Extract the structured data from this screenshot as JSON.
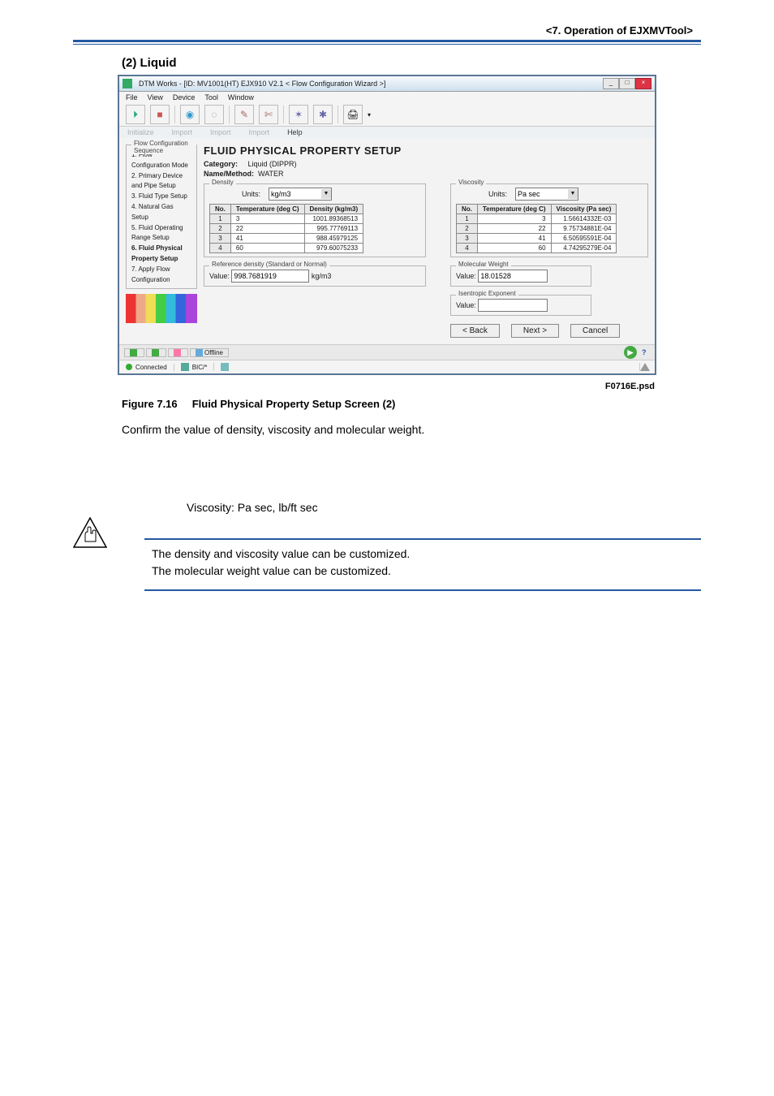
{
  "header": {
    "section": "<7.  Operation of EJXMVTool>"
  },
  "section_head": "(2)   Liquid",
  "window": {
    "title": "DTM Works - [ID: MV1001(HT) EJX910 V2.1 < Flow Configuration Wizard >]",
    "win_btns": {
      "min": "_",
      "max": "□",
      "close": "×"
    },
    "menu": {
      "file": "File",
      "view": "View",
      "device": "Device",
      "tool": "Tool",
      "window": "Window"
    },
    "tabs_label": {
      "init": "Initialize",
      "import1": "Import",
      "import2": "Import",
      "import3": "Import",
      "help": "Help"
    },
    "big_title": "FLUID PHYSICAL PROPERTY SETUP",
    "sidebar": {
      "fs_title": "Flow Configuration Sequence",
      "steps": {
        "s1": "1. Flow Configuration Mode",
        "s2": "2. Primary Device and Pipe Setup",
        "s3": "3. Fluid Type Setup",
        "s4": "4. Natural Gas Setup",
        "s5": "5. Fluid Operating Range Setup",
        "s6": "6. Fluid Physical Property Setup",
        "s7": "7. Apply Flow Configuration"
      }
    },
    "category": {
      "label": "Category:",
      "value": "Liquid (DIPPR)",
      "label2": "Name/Method:",
      "value2": "WATER"
    },
    "density": {
      "fs_title": "Density",
      "units_label": "Units:",
      "units_value": "kg/m3",
      "th": {
        "no": "No.",
        "temp": "Temperature (deg C)",
        "dens": "Density (kg/m3)"
      },
      "rows": [
        {
          "n": "1",
          "t": "3",
          "d": "1001.89368513"
        },
        {
          "n": "2",
          "t": "22",
          "d": "995.77769113"
        },
        {
          "n": "3",
          "t": "41",
          "d": "988.45979125"
        },
        {
          "n": "4",
          "t": "60",
          "d": "979.60075233"
        }
      ]
    },
    "ref": {
      "fs_title": "Reference density (Standard or Normal)",
      "label": "Value:",
      "value": "998.7681919",
      "unit": "kg/m3"
    },
    "viscosity": {
      "fs_title": "Viscosity",
      "units_label": "Units:",
      "units_value": "Pa sec",
      "th": {
        "no": "No.",
        "temp": "Temperature (deg C)",
        "visc": "Viscosity (Pa sec)"
      },
      "rows": [
        {
          "n": "1",
          "t": "3",
          "v": "1.56614332E-03"
        },
        {
          "n": "2",
          "t": "22",
          "v": "9.75734881E-04"
        },
        {
          "n": "3",
          "t": "41",
          "v": "6.50595591E-04"
        },
        {
          "n": "4",
          "t": "60",
          "v": "4.74295279E-04"
        }
      ]
    },
    "mol": {
      "fs_title": "Molecular Weight",
      "label": "Value:",
      "value": "18.01528"
    },
    "iso": {
      "fs_title": "Isentropic Exponent",
      "label": "Value:",
      "value": ""
    },
    "buttons": {
      "back": "< Back",
      "next": "Next >",
      "cancel": "Cancel"
    },
    "tabs": {
      "t0": "",
      "t1": "",
      "t2": "",
      "t3": "Offline"
    },
    "status": {
      "conn": "Connected",
      "net": "BIC/*"
    }
  },
  "psd_label": "F0716E.psd",
  "fig": {
    "num": "Figure 7.16",
    "caption": "Fluid Physical Property Setup Screen (2)"
  },
  "doc": {
    "confirm": "Confirm the value of density, viscosity and molecular weight.",
    "visc": "Viscosity: Pa sec, lb/ft sec",
    "note1": "The density and viscosity value can be customized.",
    "note2": "The molecular weight value can be customized."
  }
}
